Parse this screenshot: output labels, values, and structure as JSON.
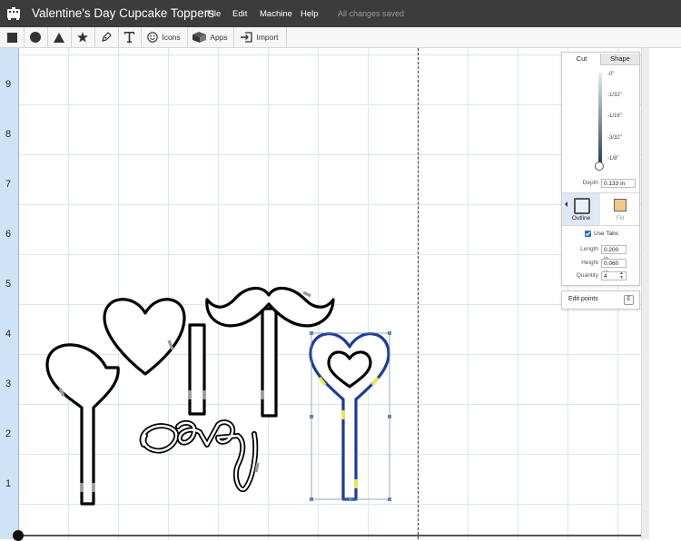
{
  "app": {
    "title": "Valentine's Day Cupcake Toppers",
    "menu": [
      "File",
      "Edit",
      "Machine",
      "Help"
    ],
    "save_status": "All changes saved"
  },
  "toolbar": {
    "tools": [
      {
        "name": "rectangle-tool",
        "icon": "square-icon"
      },
      {
        "name": "circle-tool",
        "icon": "circle-icon"
      },
      {
        "name": "triangle-tool",
        "icon": "triangle-icon"
      },
      {
        "name": "star-tool",
        "icon": "star-icon"
      },
      {
        "name": "pen-tool",
        "icon": "pen-icon"
      },
      {
        "name": "text-tool",
        "icon": "text-icon"
      }
    ],
    "icons_label": "Icons",
    "apps_label": "Apps",
    "import_label": "Import"
  },
  "ruler": {
    "labels": [
      "9",
      "8",
      "7",
      "6",
      "5",
      "4",
      "3",
      "2",
      "1"
    ]
  },
  "panel": {
    "tabs": [
      "Cut",
      "Shape"
    ],
    "active_tab": "Cut",
    "depth_marks": [
      "-0\"",
      "-1/32\"",
      "-1/16\"",
      "-3/32\"",
      "-1/8\""
    ],
    "depth_label": "Depth",
    "depth_value": "0.133 in",
    "mode_outline": "Outline",
    "mode_fill": "Fill",
    "active_mode": "Outline",
    "use_tabs_label": "Use Tabs",
    "use_tabs_checked": true,
    "length_label": "Length",
    "length_value": "0.200 in",
    "height_label": "Height",
    "height_value": "0.060 in",
    "quantity_label": "Quantity",
    "quantity_value": "4"
  },
  "edit_points": {
    "label": "Edit points",
    "shortcut": "E"
  },
  "colors": {
    "titlebar": "#3c3c3c",
    "ruler": "#cfe3f6",
    "grid": "#d7e6f4",
    "selection": "#6b86a6",
    "tab_marker": "#e9e94a",
    "accent": "#2f6fb5"
  }
}
